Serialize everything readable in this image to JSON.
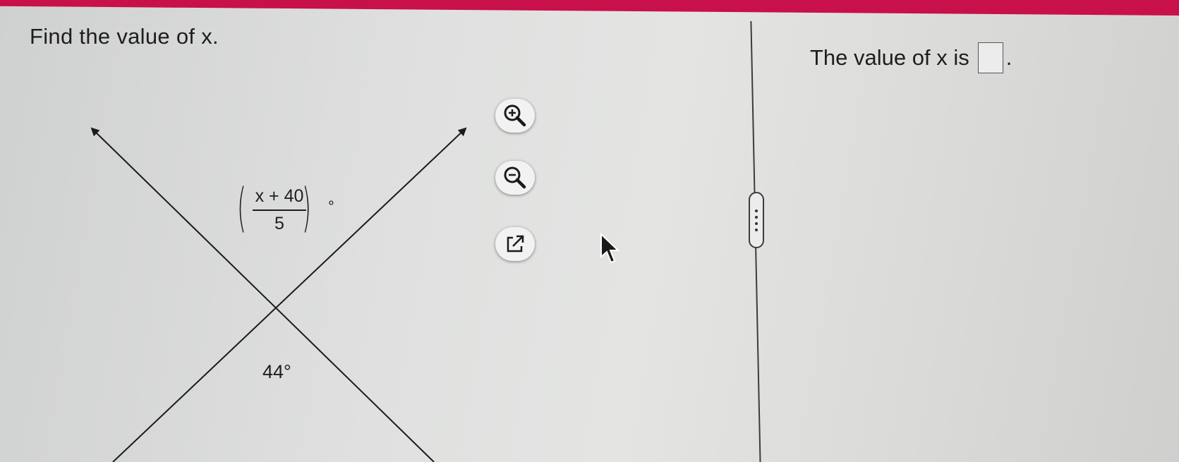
{
  "header": {
    "accent_color": "#c8104a"
  },
  "question": {
    "prompt": "Find the value of x."
  },
  "figure": {
    "angle_top_numerator": "x + 40",
    "angle_top_denominator": "5",
    "angle_top_degree": "°",
    "angle_bottom": "44°"
  },
  "tools": {
    "zoom_in_icon": "zoom-in-icon",
    "zoom_out_icon": "zoom-out-icon",
    "popout_icon": "external-link-icon"
  },
  "answer": {
    "text": "The value of x is",
    "input_value": "",
    "period": "."
  }
}
